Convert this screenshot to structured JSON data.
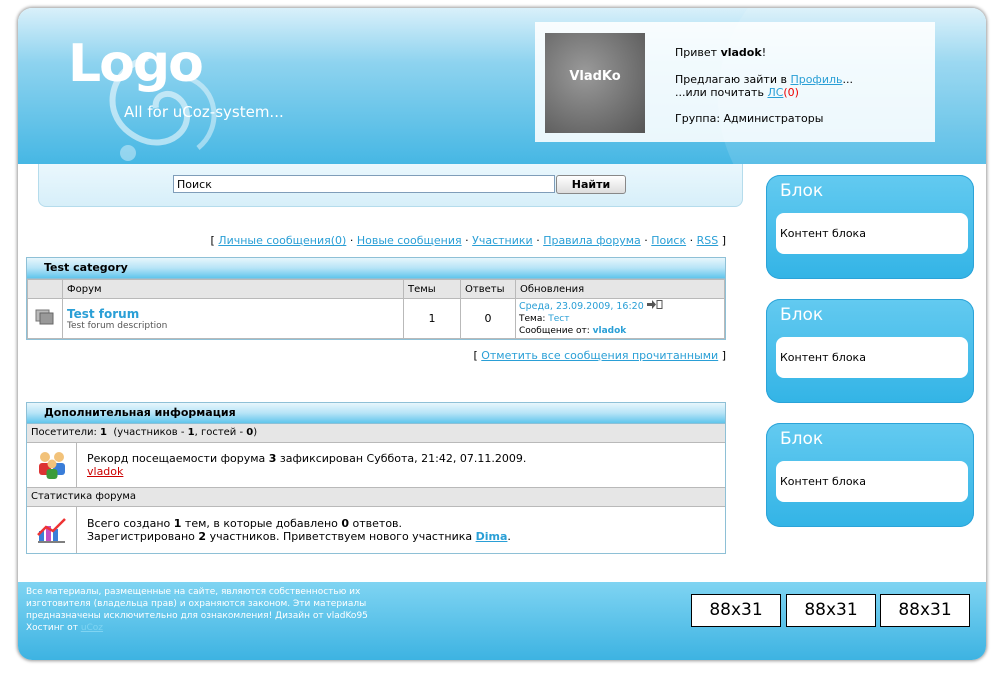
{
  "header": {
    "logo": "Logo",
    "slogan": "All for uCoz-system..."
  },
  "user_panel": {
    "avatar_text": "VladKo",
    "greeting_prefix": "Привет",
    "username": "vladok",
    "greeting_suffix": "!",
    "profile_prefix": "Предлагаю зайти в",
    "profile_link": "Профиль",
    "profile_suffix": "...",
    "pm_prefix": "...или почитать",
    "pm_link": "ЛС",
    "pm_count": "(0)",
    "group_label": "Группа: Администраторы"
  },
  "search": {
    "value": "Поиск",
    "button": "Найти"
  },
  "forum_nav": {
    "open": "[",
    "close": "]",
    "sep": "·",
    "links": [
      "Личные сообщения(0)",
      "Новые сообщения",
      "Участники",
      "Правила форума",
      "Поиск",
      "RSS"
    ]
  },
  "category": {
    "title": "Test category",
    "columns": [
      "Форум",
      "Темы",
      "Ответы",
      "Обновления"
    ],
    "forum": {
      "name": "Test forum",
      "description": "Test forum description",
      "topics": "1",
      "replies": "0",
      "update_date": "Среда, 23.09.2009, 16:20",
      "topic_label": "Тема:",
      "topic_name": "Тест",
      "msg_label": "Сообщение от:",
      "msg_user": "vladok"
    }
  },
  "mark_read": {
    "open": "[",
    "link": "Отметить все сообщения прочитанными",
    "close": "]"
  },
  "info": {
    "title": "Дополнительная информация",
    "visitors_bar": {
      "label": "Посетители:",
      "total": "1",
      "members_label": "(участников -",
      "members": "1",
      "guests_label": ", гостей -",
      "guests": "0",
      "close": ")"
    },
    "record": {
      "text_a": "Рекорд посещаемости форума",
      "count": "3",
      "text_b": "зафиксирован Суббота, 21:42, 07.11.2009.",
      "user": "vladok"
    },
    "stats_bar": "Статистика форума",
    "stats": {
      "line1_a": "Всего создано",
      "topics": "1",
      "line1_b": "тем, в которые добавлено",
      "replies": "0",
      "line1_c": "ответов.",
      "line2_a": "Зарегистрировано",
      "members": "2",
      "line2_b": "участников. Приветствуем нового участника",
      "new_member": "Dima",
      "line2_c": "."
    }
  },
  "sidebar": {
    "blocks": [
      {
        "title": "Блок",
        "content": "Контент блока"
      },
      {
        "title": "Блок",
        "content": "Контент блока"
      },
      {
        "title": "Блок",
        "content": "Контент блока"
      }
    ]
  },
  "footer": {
    "text": "Все материалы, размещенные на сайте, являются собственностью их изготовителя (владельца прав) и охраняются законом. Эти материалы предназначены исключительно для ознакомления! Дизайн от vladKo95",
    "hosting_label": "Хостинг от",
    "hosting_link": "uCoz",
    "banners": [
      "88x31",
      "88x31",
      "88x31"
    ]
  },
  "colors": {
    "accent": "#2a9fd6",
    "header_blue": "#46b7e4",
    "alert_red": "#e00000"
  }
}
